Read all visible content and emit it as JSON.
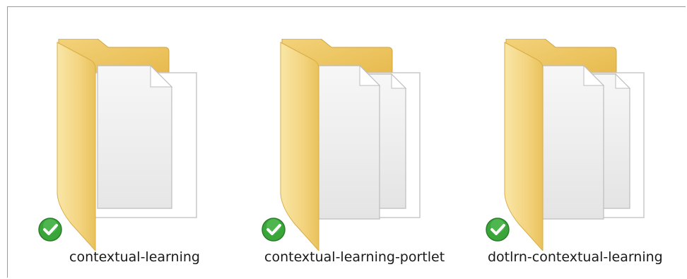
{
  "folders": [
    {
      "name": "contextual-learning",
      "pages": 1,
      "status": "synced"
    },
    {
      "name": "contextual-learning-portlet",
      "pages": 2,
      "status": "synced"
    },
    {
      "name": "dotlrn-contextual-learning",
      "pages": 2,
      "status": "synced"
    }
  ],
  "colors": {
    "folder_back": "#f0c860",
    "folder_front": "#f5d98c",
    "check_green": "#3aa63a"
  }
}
